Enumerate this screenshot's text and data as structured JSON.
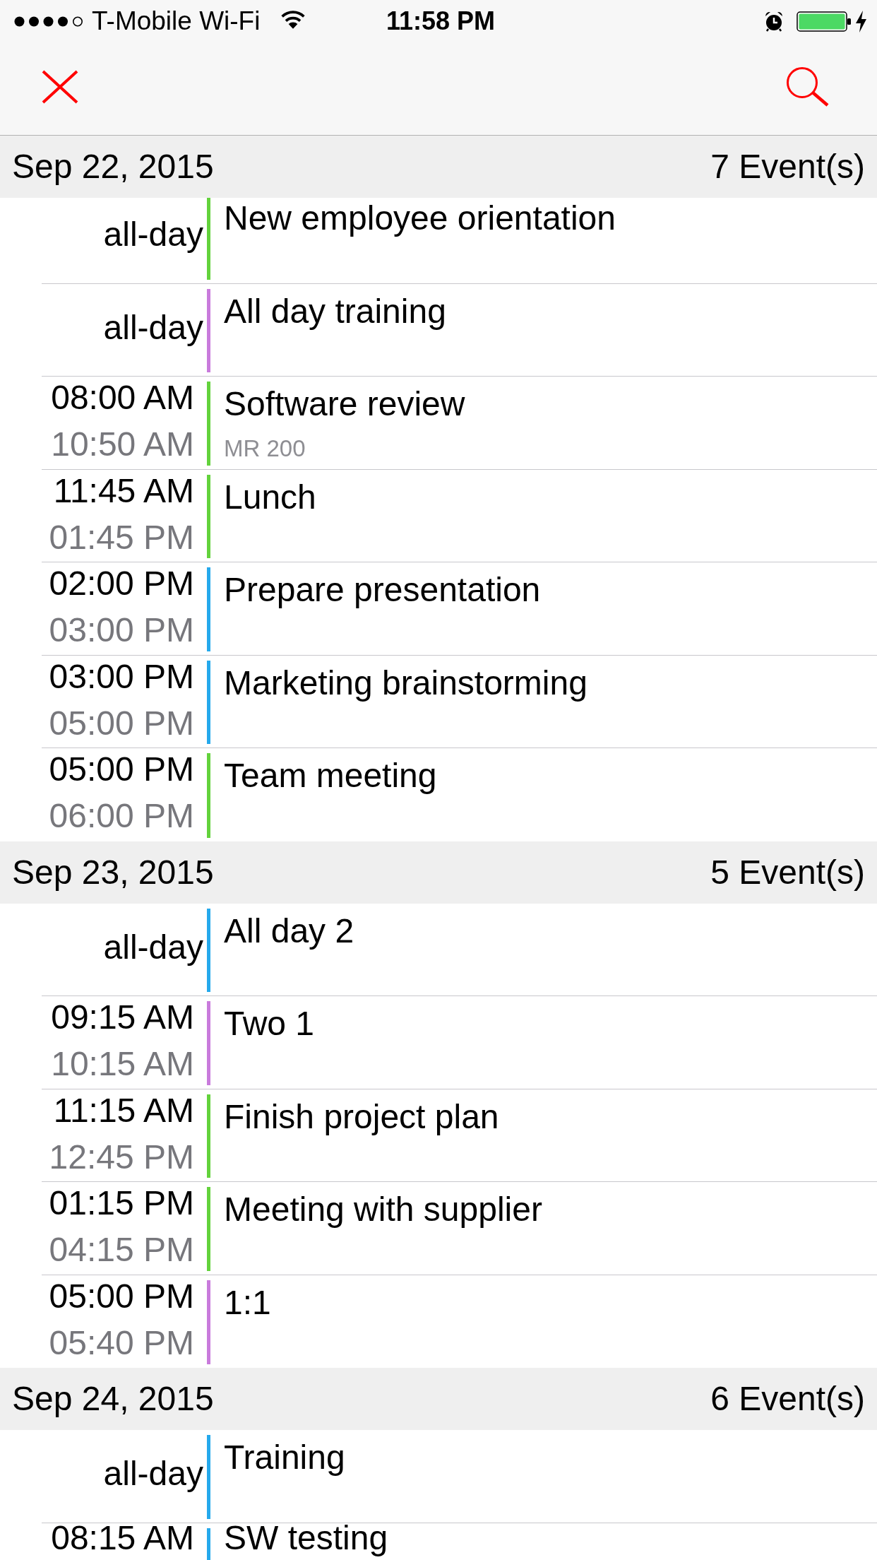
{
  "status_bar": {
    "carrier": "T-Mobile Wi-Fi",
    "time": "11:58 PM"
  },
  "sections": [
    {
      "date": "Sep 22, 2015",
      "count": "7 Event(s)",
      "events": [
        {
          "kind": "all_day",
          "time": "all-day",
          "title": "New employee orientation",
          "color": "#63d23c"
        },
        {
          "kind": "all_day",
          "time": "all-day",
          "title": "All day training",
          "color": "#c97bdc"
        },
        {
          "kind": "timed",
          "start": "08:00 AM",
          "end": "10:50 AM",
          "title": "Software review",
          "location": "MR 200",
          "color": "#63d23c"
        },
        {
          "kind": "timed",
          "start": "11:45 AM",
          "end": "01:45 PM",
          "title": "Lunch",
          "color": "#63d23c"
        },
        {
          "kind": "timed",
          "start": "02:00 PM",
          "end": "03:00 PM",
          "title": "Prepare presentation",
          "color": "#25a9ec"
        },
        {
          "kind": "timed",
          "start": "03:00 PM",
          "end": "05:00 PM",
          "title": "Marketing brainstorming",
          "color": "#25a9ec"
        },
        {
          "kind": "timed",
          "start": "05:00 PM",
          "end": "06:00 PM",
          "title": "Team meeting",
          "color": "#63d23c"
        }
      ]
    },
    {
      "date": "Sep 23, 2015",
      "count": "5 Event(s)",
      "events": [
        {
          "kind": "all_day",
          "time": "all-day",
          "title": "All day 2",
          "color": "#25a9ec"
        },
        {
          "kind": "timed",
          "start": "09:15 AM",
          "end": "10:15 AM",
          "title": "Two 1",
          "color": "#c97bdc"
        },
        {
          "kind": "timed",
          "start": "11:15 AM",
          "end": "12:45 PM",
          "title": "Finish project plan",
          "color": "#63d23c"
        },
        {
          "kind": "timed",
          "start": "01:15 PM",
          "end": "04:15 PM",
          "title": "Meeting with supplier",
          "color": "#63d23c"
        },
        {
          "kind": "timed",
          "start": "05:00 PM",
          "end": "05:40 PM",
          "title": "1:1",
          "color": "#c97bdc"
        }
      ]
    },
    {
      "date": "Sep 24, 2015",
      "count": "6 Event(s)",
      "events": [
        {
          "kind": "all_day",
          "time": "all-day",
          "title": "Training",
          "color": "#25a9ec"
        },
        {
          "kind": "timed",
          "start": "08:15 AM",
          "title": "SW testing",
          "color": "#25a9ec"
        }
      ]
    }
  ]
}
